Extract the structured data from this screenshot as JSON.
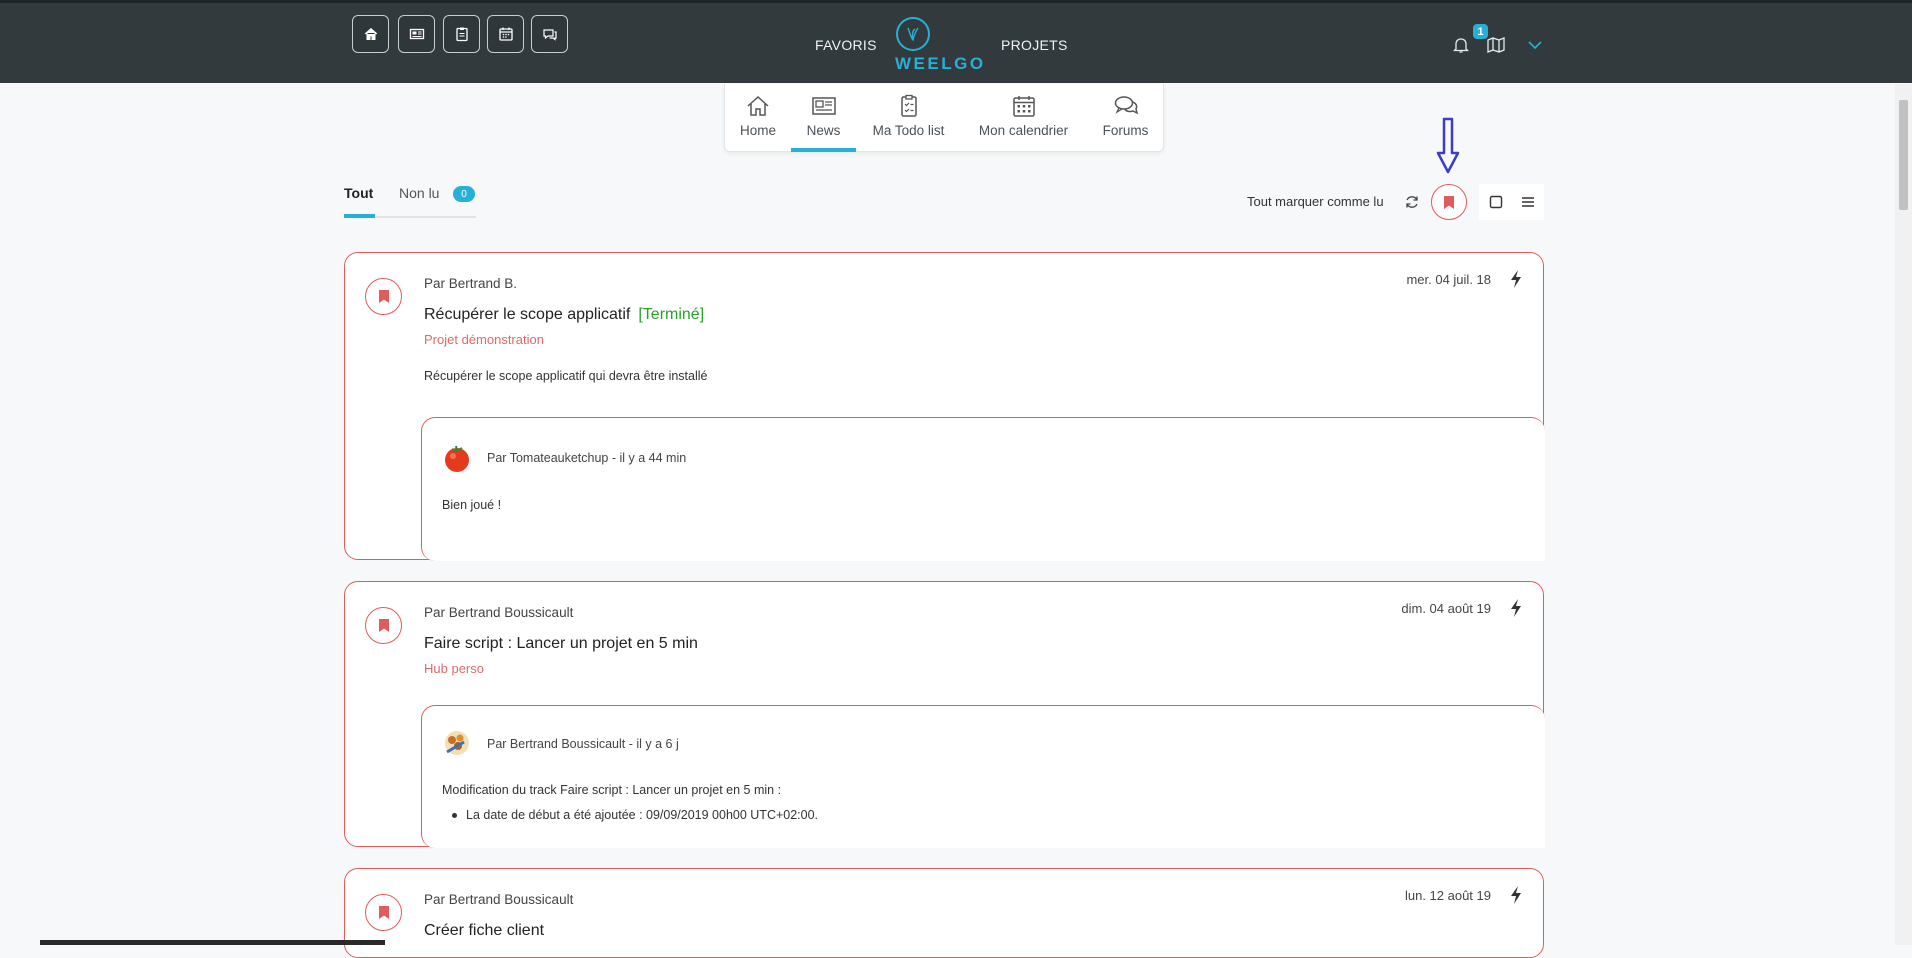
{
  "header": {
    "quick_buttons": [
      "home-icon",
      "newspaper-icon",
      "clipboard-icon",
      "calendar-icon",
      "chat-icon"
    ],
    "favoris": "FAVORIS",
    "logo_text": "WEELGO",
    "projets": "PROJETS",
    "notification_count": "1"
  },
  "subnav": {
    "items": [
      {
        "label": "Home",
        "icon": "home-icon"
      },
      {
        "label": "News",
        "icon": "newspaper-icon",
        "active": true
      },
      {
        "label": "Ma Todo list",
        "icon": "clipboard-icon"
      },
      {
        "label": "Mon calendrier",
        "icon": "calendar-icon"
      },
      {
        "label": "Forums",
        "icon": "chat-icon"
      }
    ]
  },
  "filters": {
    "tab_all": "Tout",
    "tab_unread": "Non lu",
    "unread_count": "0",
    "mark_all_read": "Tout marquer comme lu"
  },
  "colors": {
    "accent": "#27b0d6",
    "card_border": "#df5c5c",
    "topbar": "#323a3e",
    "status_done": "#2aa22a",
    "arrow": "#3c3cc4"
  },
  "cards": [
    {
      "author": "Par Bertrand B.",
      "date": "mer. 04 juil. 18",
      "title": "Récupérer le scope applicatif",
      "status": "[Terminé]",
      "project": "Projet démonstration",
      "description": "Récupérer le scope applicatif qui devra être installé",
      "comment": {
        "avatar": "tomato",
        "meta": "Par Tomateauketchup - il y a 44 min",
        "text": "Bien joué !"
      }
    },
    {
      "author": "Par Bertrand Boussicault",
      "date": "dim. 04 août 19",
      "title": "Faire script : Lancer un projet en 5 min",
      "project": "Hub perso",
      "comment": {
        "avatar": "food",
        "meta": "Par Bertrand Boussicault - il y a 6 j",
        "text": "Modification du track Faire script : Lancer un projet en 5 min :",
        "bullet": "La date de début a été ajoutée : 09/09/2019 00h00 UTC+02:00."
      }
    },
    {
      "author": "Par Bertrand Boussicault",
      "date": "lun. 12 août 19",
      "title": "Créer fiche client"
    }
  ]
}
